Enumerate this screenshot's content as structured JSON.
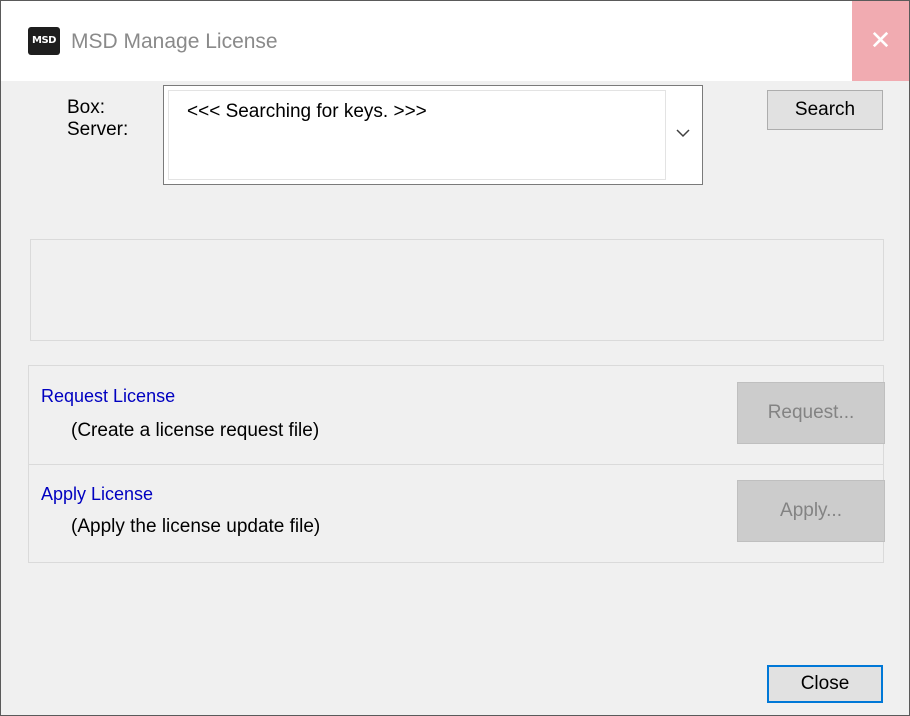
{
  "window": {
    "icon_text": "MSD",
    "title": "MSD Manage License",
    "close_glyph": "✕"
  },
  "server_select": {
    "label_line1": "Box:",
    "label_line2": "Server:",
    "value": "<<< Searching for keys. >>>"
  },
  "buttons": {
    "search": "Search",
    "request": "Request...",
    "apply": "Apply...",
    "close": "Close"
  },
  "request_section": {
    "title": "Request License",
    "description": "(Create a license request file)"
  },
  "apply_section": {
    "title": "Apply License",
    "description": "(Apply the license update file)"
  },
  "icons": {
    "app": "msd-logo-icon",
    "dropdown": "chevron-down-icon",
    "close": "close-icon"
  },
  "colors": {
    "link_blue": "#0000c0",
    "close_hover": "#f1abb1",
    "default_button_border": "#0078d7"
  }
}
